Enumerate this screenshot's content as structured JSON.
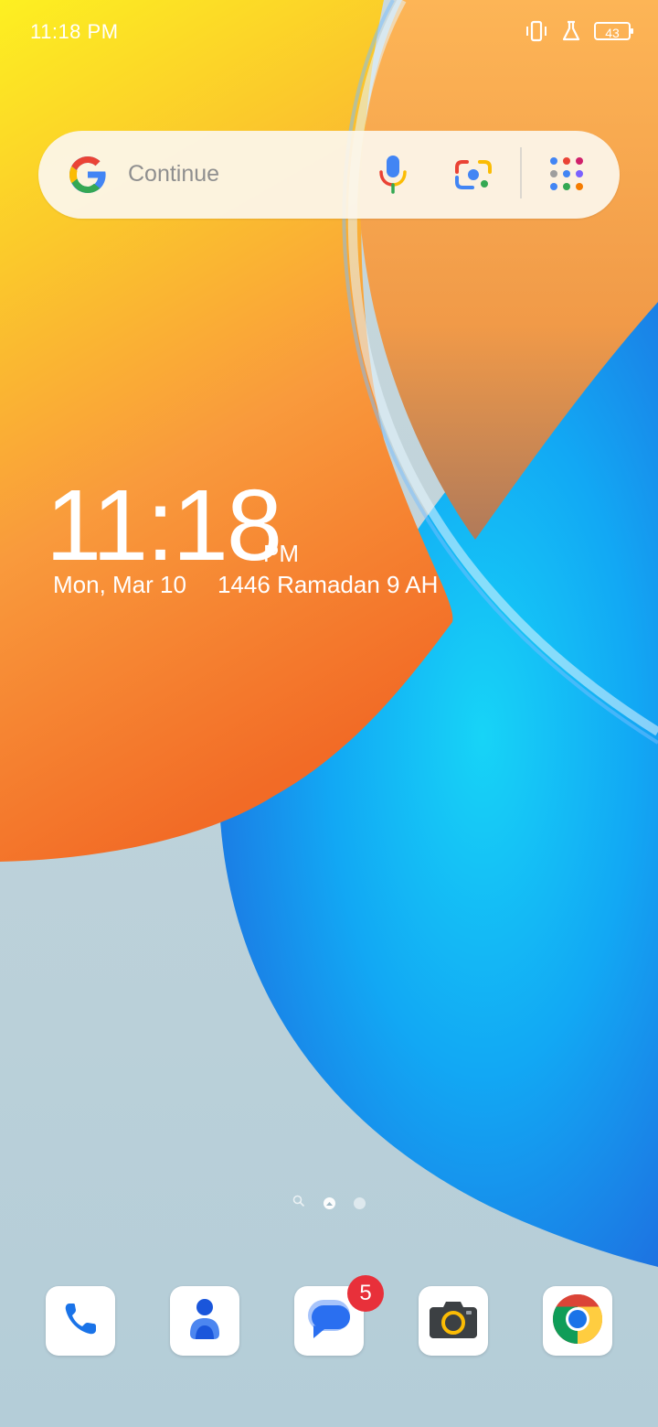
{
  "status_bar": {
    "time": "11:18 PM",
    "battery_level": "43",
    "icons": [
      "vibrate-icon",
      "lab-flask-icon",
      "battery-icon"
    ]
  },
  "search_bar": {
    "placeholder": "Continue",
    "icons": [
      "google-logo-icon",
      "microphone-icon",
      "google-lens-icon",
      "apps-grid-icon"
    ]
  },
  "clock_widget": {
    "time": "11:18",
    "ampm": "PM",
    "date": "Mon, Mar 10",
    "hijri_date": "1446 Ramadan 9 AH"
  },
  "page_indicator": {
    "pages": [
      "search-page",
      "home-page",
      "page-2"
    ],
    "active_index": 1
  },
  "dock": {
    "apps": [
      {
        "name": "Phone",
        "icon": "phone-icon"
      },
      {
        "name": "Contacts",
        "icon": "contacts-icon"
      },
      {
        "name": "Messages",
        "icon": "messages-icon",
        "badge": "5"
      },
      {
        "name": "Camera",
        "icon": "camera-icon"
      },
      {
        "name": "Chrome",
        "icon": "chrome-icon"
      }
    ]
  },
  "colors": {
    "badge": "#e8303a",
    "google_blue": "#4285f4",
    "google_red": "#ea4335",
    "google_yellow": "#fbbc04",
    "google_green": "#34a853",
    "wallpaper_yellow": "#fbe319",
    "wallpaper_orange": "#f5792e",
    "wallpaper_blue": "#1a9ef5",
    "wallpaper_background": "#b9cfd8"
  }
}
